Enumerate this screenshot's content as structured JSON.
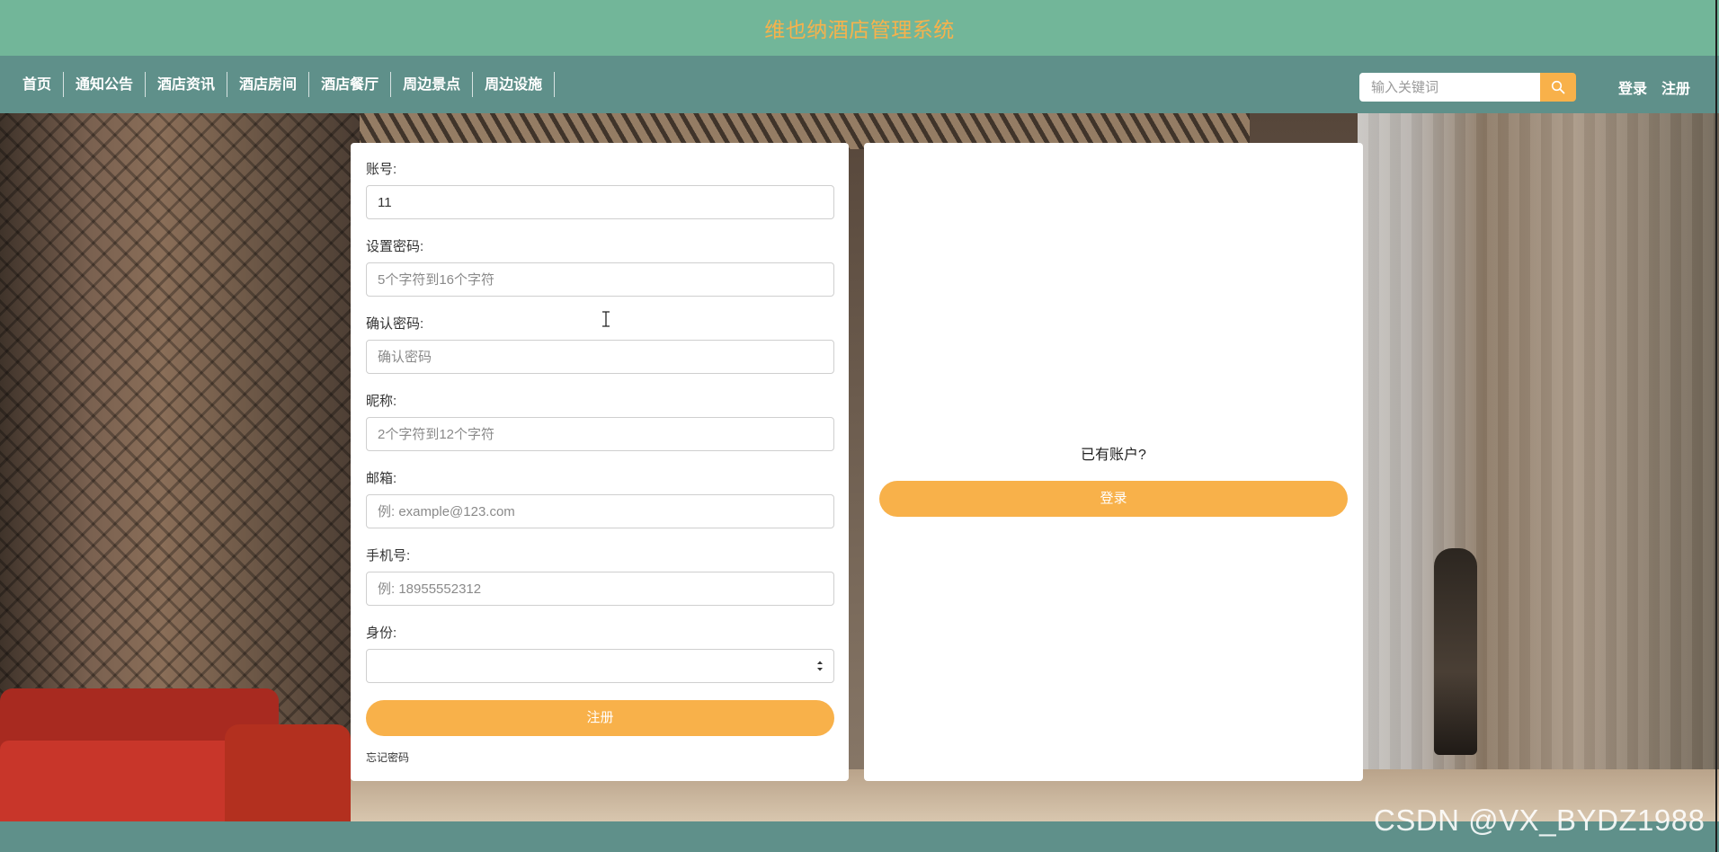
{
  "header": {
    "site_title": "维也纳酒店管理系统"
  },
  "nav": {
    "items": [
      "首页",
      "通知公告",
      "酒店资讯",
      "酒店房间",
      "酒店餐厅",
      "周边景点",
      "周边设施"
    ],
    "search_placeholder": "输入关键词",
    "login_label": "登录",
    "register_label": "注册"
  },
  "register_form": {
    "account_label": "账号:",
    "account_value": "11",
    "password_label": "设置密码:",
    "password_placeholder": "5个字符到16个字符",
    "confirm_label": "确认密码:",
    "confirm_placeholder": "确认密码",
    "nickname_label": "昵称:",
    "nickname_placeholder": "2个字符到12个字符",
    "email_label": "邮箱:",
    "email_placeholder": "例: example@123.com",
    "phone_label": "手机号:",
    "phone_placeholder": "例: 18955552312",
    "role_label": "身份:",
    "role_value": "",
    "submit_label": "注册",
    "forgot_label": "忘记密码"
  },
  "login_panel": {
    "prompt": "已有账户?",
    "button_label": "登录"
  },
  "watermark": "CSDN @VX_BYDZ1988",
  "colors": {
    "header_bg": "#72b699",
    "nav_bg": "#5f908a",
    "accent": "#f8b14a",
    "title_color": "#f7b24c"
  }
}
